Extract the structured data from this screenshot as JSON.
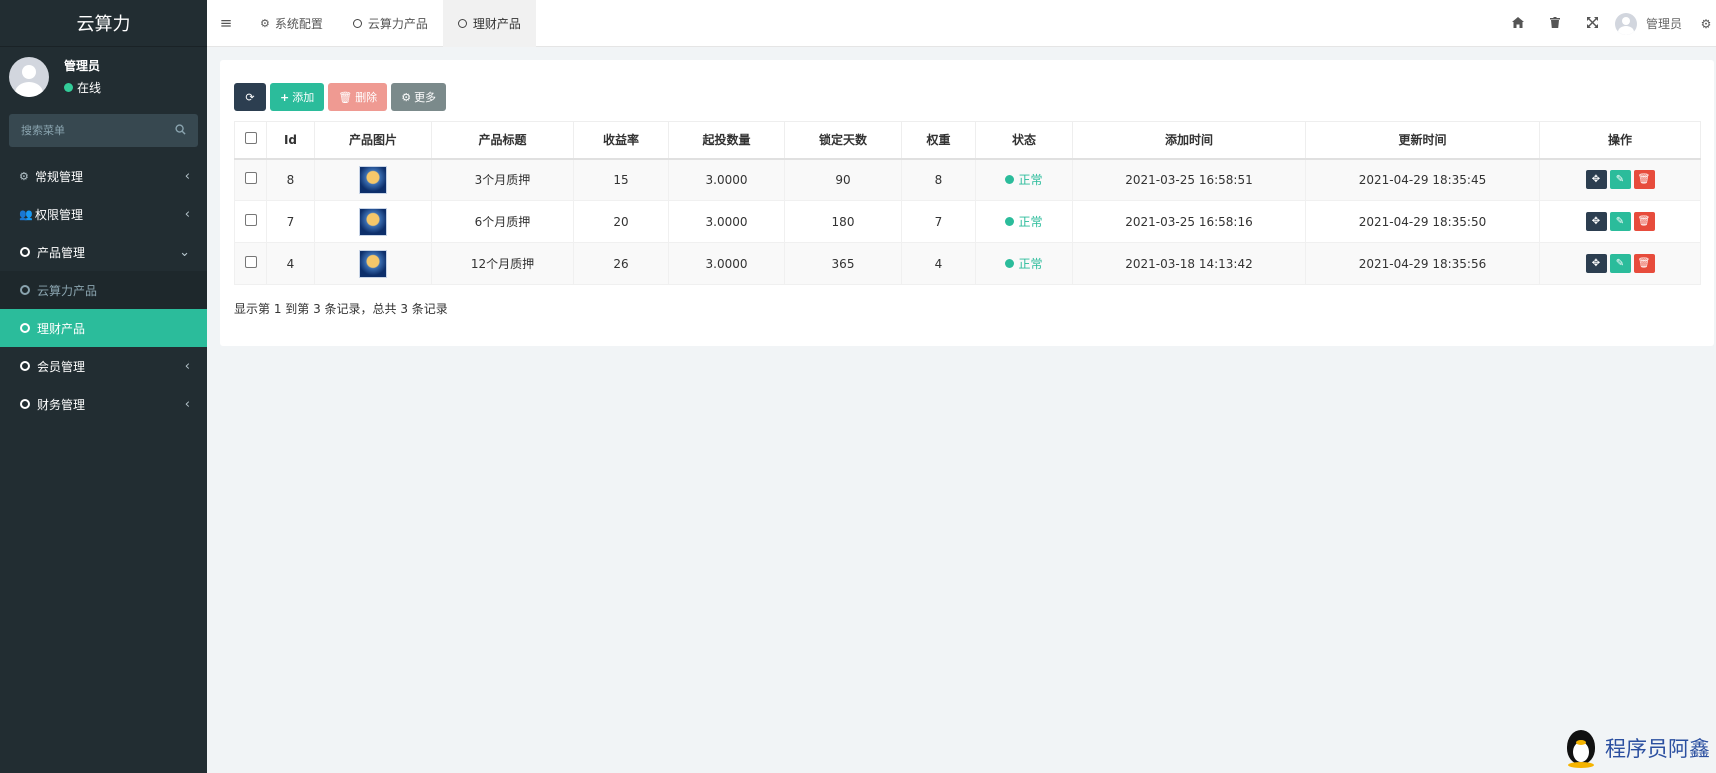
{
  "sidebar": {
    "brand": "云算力",
    "user_name": "管理员",
    "user_status": "在线",
    "search_placeholder": "搜索菜单",
    "items": [
      {
        "label": "常规管理"
      },
      {
        "label": "权限管理"
      },
      {
        "label": "产品管理"
      },
      {
        "label": "云算力产品"
      },
      {
        "label": "理财产品"
      },
      {
        "label": "会员管理"
      },
      {
        "label": "财务管理"
      }
    ]
  },
  "topbar": {
    "tabs": [
      {
        "label": "系统配置"
      },
      {
        "label": "云算力产品"
      },
      {
        "label": "理财产品"
      }
    ],
    "user_name": "管理员"
  },
  "toolbar": {
    "add_label": "添加",
    "delete_label": "删除",
    "more_label": "更多"
  },
  "table": {
    "headers": [
      "Id",
      "产品图片",
      "产品标题",
      "收益率",
      "起投数量",
      "锁定天数",
      "权重",
      "状态",
      "添加时间",
      "更新时间",
      "操作"
    ],
    "rows": [
      {
        "id": "8",
        "title": "3个月质押",
        "rate": "15",
        "min_qty": "3.0000",
        "lock_days": "90",
        "weight": "8",
        "status": "正常",
        "created": "2021-03-25 16:58:51",
        "updated": "2021-04-29 18:35:45"
      },
      {
        "id": "7",
        "title": "6个月质押",
        "rate": "20",
        "min_qty": "3.0000",
        "lock_days": "180",
        "weight": "7",
        "status": "正常",
        "created": "2021-03-25 16:58:16",
        "updated": "2021-04-29 18:35:50"
      },
      {
        "id": "4",
        "title": "12个月质押",
        "rate": "26",
        "min_qty": "3.0000",
        "lock_days": "365",
        "weight": "4",
        "status": "正常",
        "created": "2021-03-18 14:13:42",
        "updated": "2021-04-29 18:35:56"
      }
    ]
  },
  "pagination_text": "显示第 1 到第 3 条记录，总共 3 条记录",
  "watermark": "程序员阿鑫",
  "colors": {
    "sidebar_bg": "#222d32",
    "accent": "#2bbc9b",
    "danger": "#e74c3c",
    "dark_button": "#2c3e50"
  }
}
